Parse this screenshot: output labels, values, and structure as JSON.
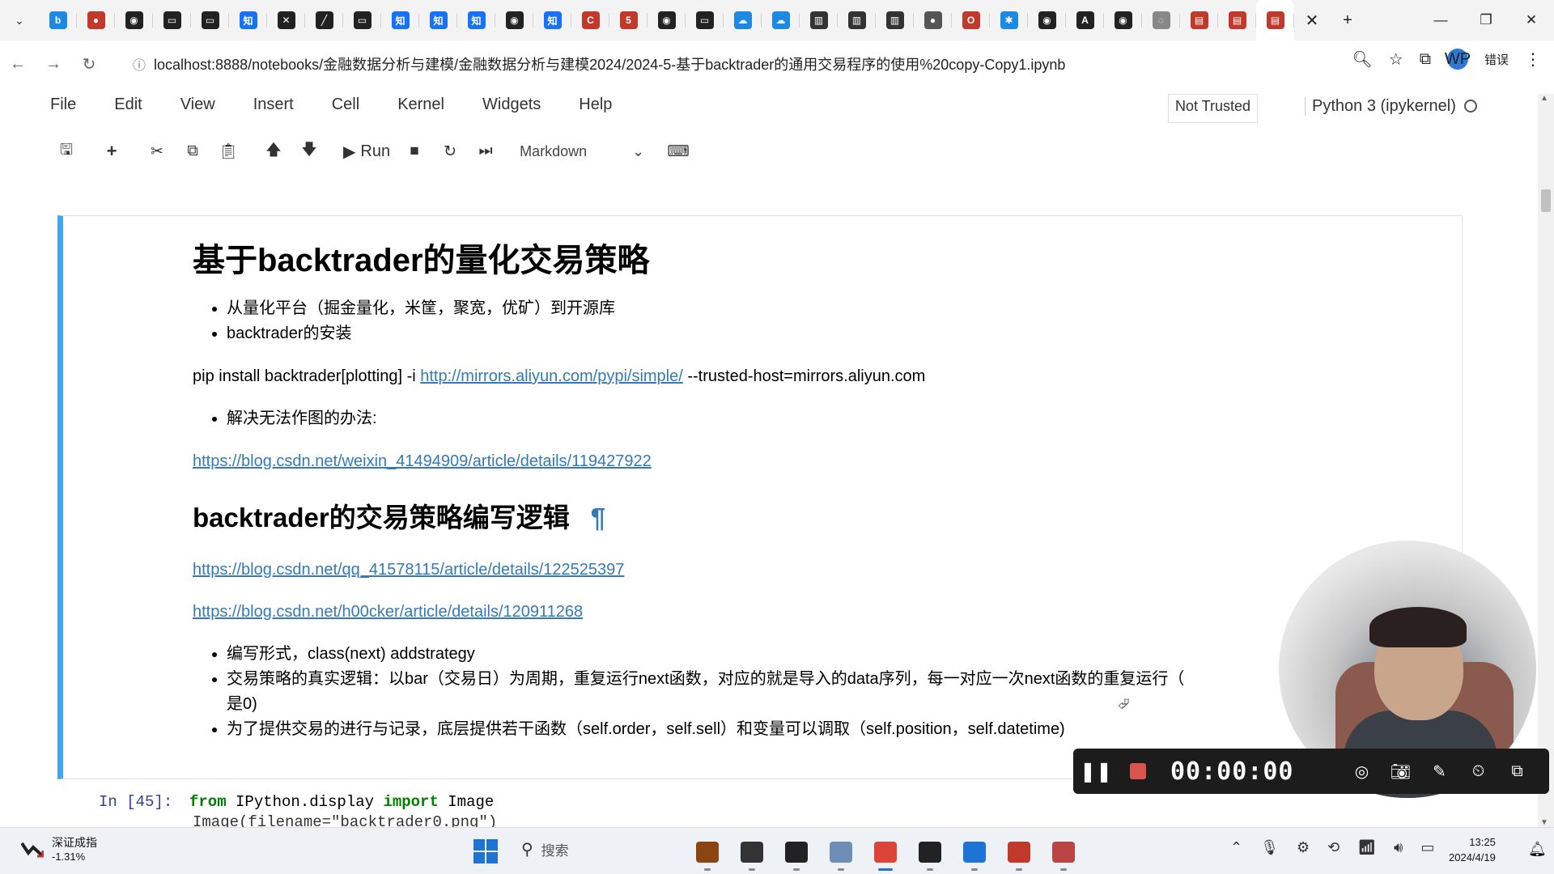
{
  "browser": {
    "tab_favicons": [
      {
        "name": "bilibili-icon",
        "color": "#1e88e5",
        "glyph": "b"
      },
      {
        "name": "netease-music-icon",
        "color": "#c0392b",
        "glyph": "●"
      },
      {
        "name": "github-icon",
        "color": "#222222",
        "glyph": "◉"
      },
      {
        "name": "video-icon",
        "color": "#222222",
        "glyph": "▭"
      },
      {
        "name": "video-icon",
        "color": "#222222",
        "glyph": "▭"
      },
      {
        "name": "zhihu-icon",
        "color": "#1772f6",
        "glyph": "知"
      },
      {
        "name": "tools-icon",
        "color": "#222222",
        "glyph": "✕"
      },
      {
        "name": "app-icon",
        "color": "#222222",
        "glyph": "╱"
      },
      {
        "name": "video-icon",
        "color": "#222222",
        "glyph": "▭"
      },
      {
        "name": "zhihu-icon",
        "color": "#1772f6",
        "glyph": "知"
      },
      {
        "name": "zhihu-icon",
        "color": "#1772f6",
        "glyph": "知"
      },
      {
        "name": "zhihu-icon",
        "color": "#1772f6",
        "glyph": "知"
      },
      {
        "name": "github-icon",
        "color": "#222222",
        "glyph": "◉"
      },
      {
        "name": "zhihu-icon",
        "color": "#1772f6",
        "glyph": "知"
      },
      {
        "name": "csdn-icon",
        "color": "#c0392b",
        "glyph": "C"
      },
      {
        "name": "51cto-icon",
        "color": "#c0392b",
        "glyph": "5"
      },
      {
        "name": "github-icon",
        "color": "#222222",
        "glyph": "◉"
      },
      {
        "name": "video-icon",
        "color": "#222222",
        "glyph": "▭"
      },
      {
        "name": "cloud-icon",
        "color": "#1e88e5",
        "glyph": "☁"
      },
      {
        "name": "cloud-icon",
        "color": "#1e88e5",
        "glyph": "☁"
      },
      {
        "name": "reader-icon",
        "color": "#333333",
        "glyph": "▥"
      },
      {
        "name": "reader-icon",
        "color": "#333333",
        "glyph": "▥"
      },
      {
        "name": "reader-icon",
        "color": "#333333",
        "glyph": "▥"
      },
      {
        "name": "avatar-icon",
        "color": "#555555",
        "glyph": "●"
      },
      {
        "name": "opera-icon",
        "color": "#c0392b",
        "glyph": "O"
      },
      {
        "name": "settings-icon",
        "color": "#1e88e5",
        "glyph": "✱"
      },
      {
        "name": "github-icon",
        "color": "#222222",
        "glyph": "◉"
      },
      {
        "name": "text-icon",
        "color": "#222222",
        "glyph": "A"
      },
      {
        "name": "github-icon",
        "color": "#222222",
        "glyph": "◉"
      },
      {
        "name": "loading-icon",
        "color": "#888888",
        "glyph": "◌"
      },
      {
        "name": "book-icon",
        "color": "#c0392b",
        "glyph": "▤"
      },
      {
        "name": "book-icon",
        "color": "#c0392b",
        "glyph": "▤"
      },
      {
        "name": "book-icon",
        "color": "#c0392b",
        "glyph": "▤"
      }
    ],
    "url": "localhost:8888/notebooks/金融数据分析与建模/金融数据分析与建模2024/2024-5-基于backtrader的通用交易程序的使用%20copy-Copy1.ipynb",
    "error_label": "错误"
  },
  "jupyter": {
    "menu": [
      "File",
      "Edit",
      "View",
      "Insert",
      "Cell",
      "Kernel",
      "Widgets",
      "Help"
    ],
    "trusted": "Not Trusted",
    "kernel": "Python 3 (ipykernel)",
    "toolbar": {
      "run_label": "Run",
      "cell_type": "Markdown"
    }
  },
  "notebook": {
    "h1": "基于backtrader的量化交易策略",
    "bullets1": [
      "从量化平台（掘金量化，米筐，聚宽，优矿）到开源库",
      "backtrader的安装"
    ],
    "pip_prefix": "pip install backtrader[plotting] -i ",
    "pip_link": "http://mirrors.aliyun.com/pypi/simple/",
    "pip_suffix": " --trusted-host=mirrors.aliyun.com",
    "bullets2": [
      "解决无法作图的办法:"
    ],
    "link1": "https://blog.csdn.net/weixin_41494909/article/details/119427922",
    "h2": "backtrader的交易策略编写逻辑",
    "pilcrow": "¶",
    "link2": "https://blog.csdn.net/qq_41578115/article/details/122525397",
    "link3": "https://blog.csdn.net/h00cker/article/details/120911268",
    "bullets3": [
      "编写形式，class(next) addstrategy",
      "交易策略的真实逻辑：以bar（交易日）为周期，重复运行next函数，对应的就是导入的data序列，每一对应一次next函数的重复运行（",
      "是0)",
      "为了提供交易的进行与记录，底层提供若干函数（self.order，self.sell）和变量可以调取（self.position，self.datetime)"
    ],
    "code_prompt": "In  [45]:",
    "code_from": "from",
    "code_module": " IPython.display ",
    "code_import": "import",
    "code_name": " Image",
    "code_line2": "Image(filename=\"backtrader0.png\")"
  },
  "recorder": {
    "time": "00:00:00"
  },
  "taskbar": {
    "stock_name": "深证成指",
    "stock_change": "-1.31%",
    "search_placeholder": "搜索",
    "apps": [
      {
        "name": "app-icon",
        "color": "#8b4513"
      },
      {
        "name": "file-explorer-icon",
        "color": "#333333"
      },
      {
        "name": "terminal-icon",
        "color": "#222222"
      },
      {
        "name": "folder-icon",
        "color": "#6d8fb5"
      },
      {
        "name": "chrome-icon",
        "color": "#db4437"
      },
      {
        "name": "cmd-icon",
        "color": "#222222"
      },
      {
        "name": "bookmark-app-icon",
        "color": "#1e74d6"
      },
      {
        "name": "wps-icon",
        "color": "#c0392b"
      },
      {
        "name": "recorder-app-icon",
        "color": "#b44"
      }
    ],
    "time": "13:25",
    "date": "2024/4/19"
  }
}
